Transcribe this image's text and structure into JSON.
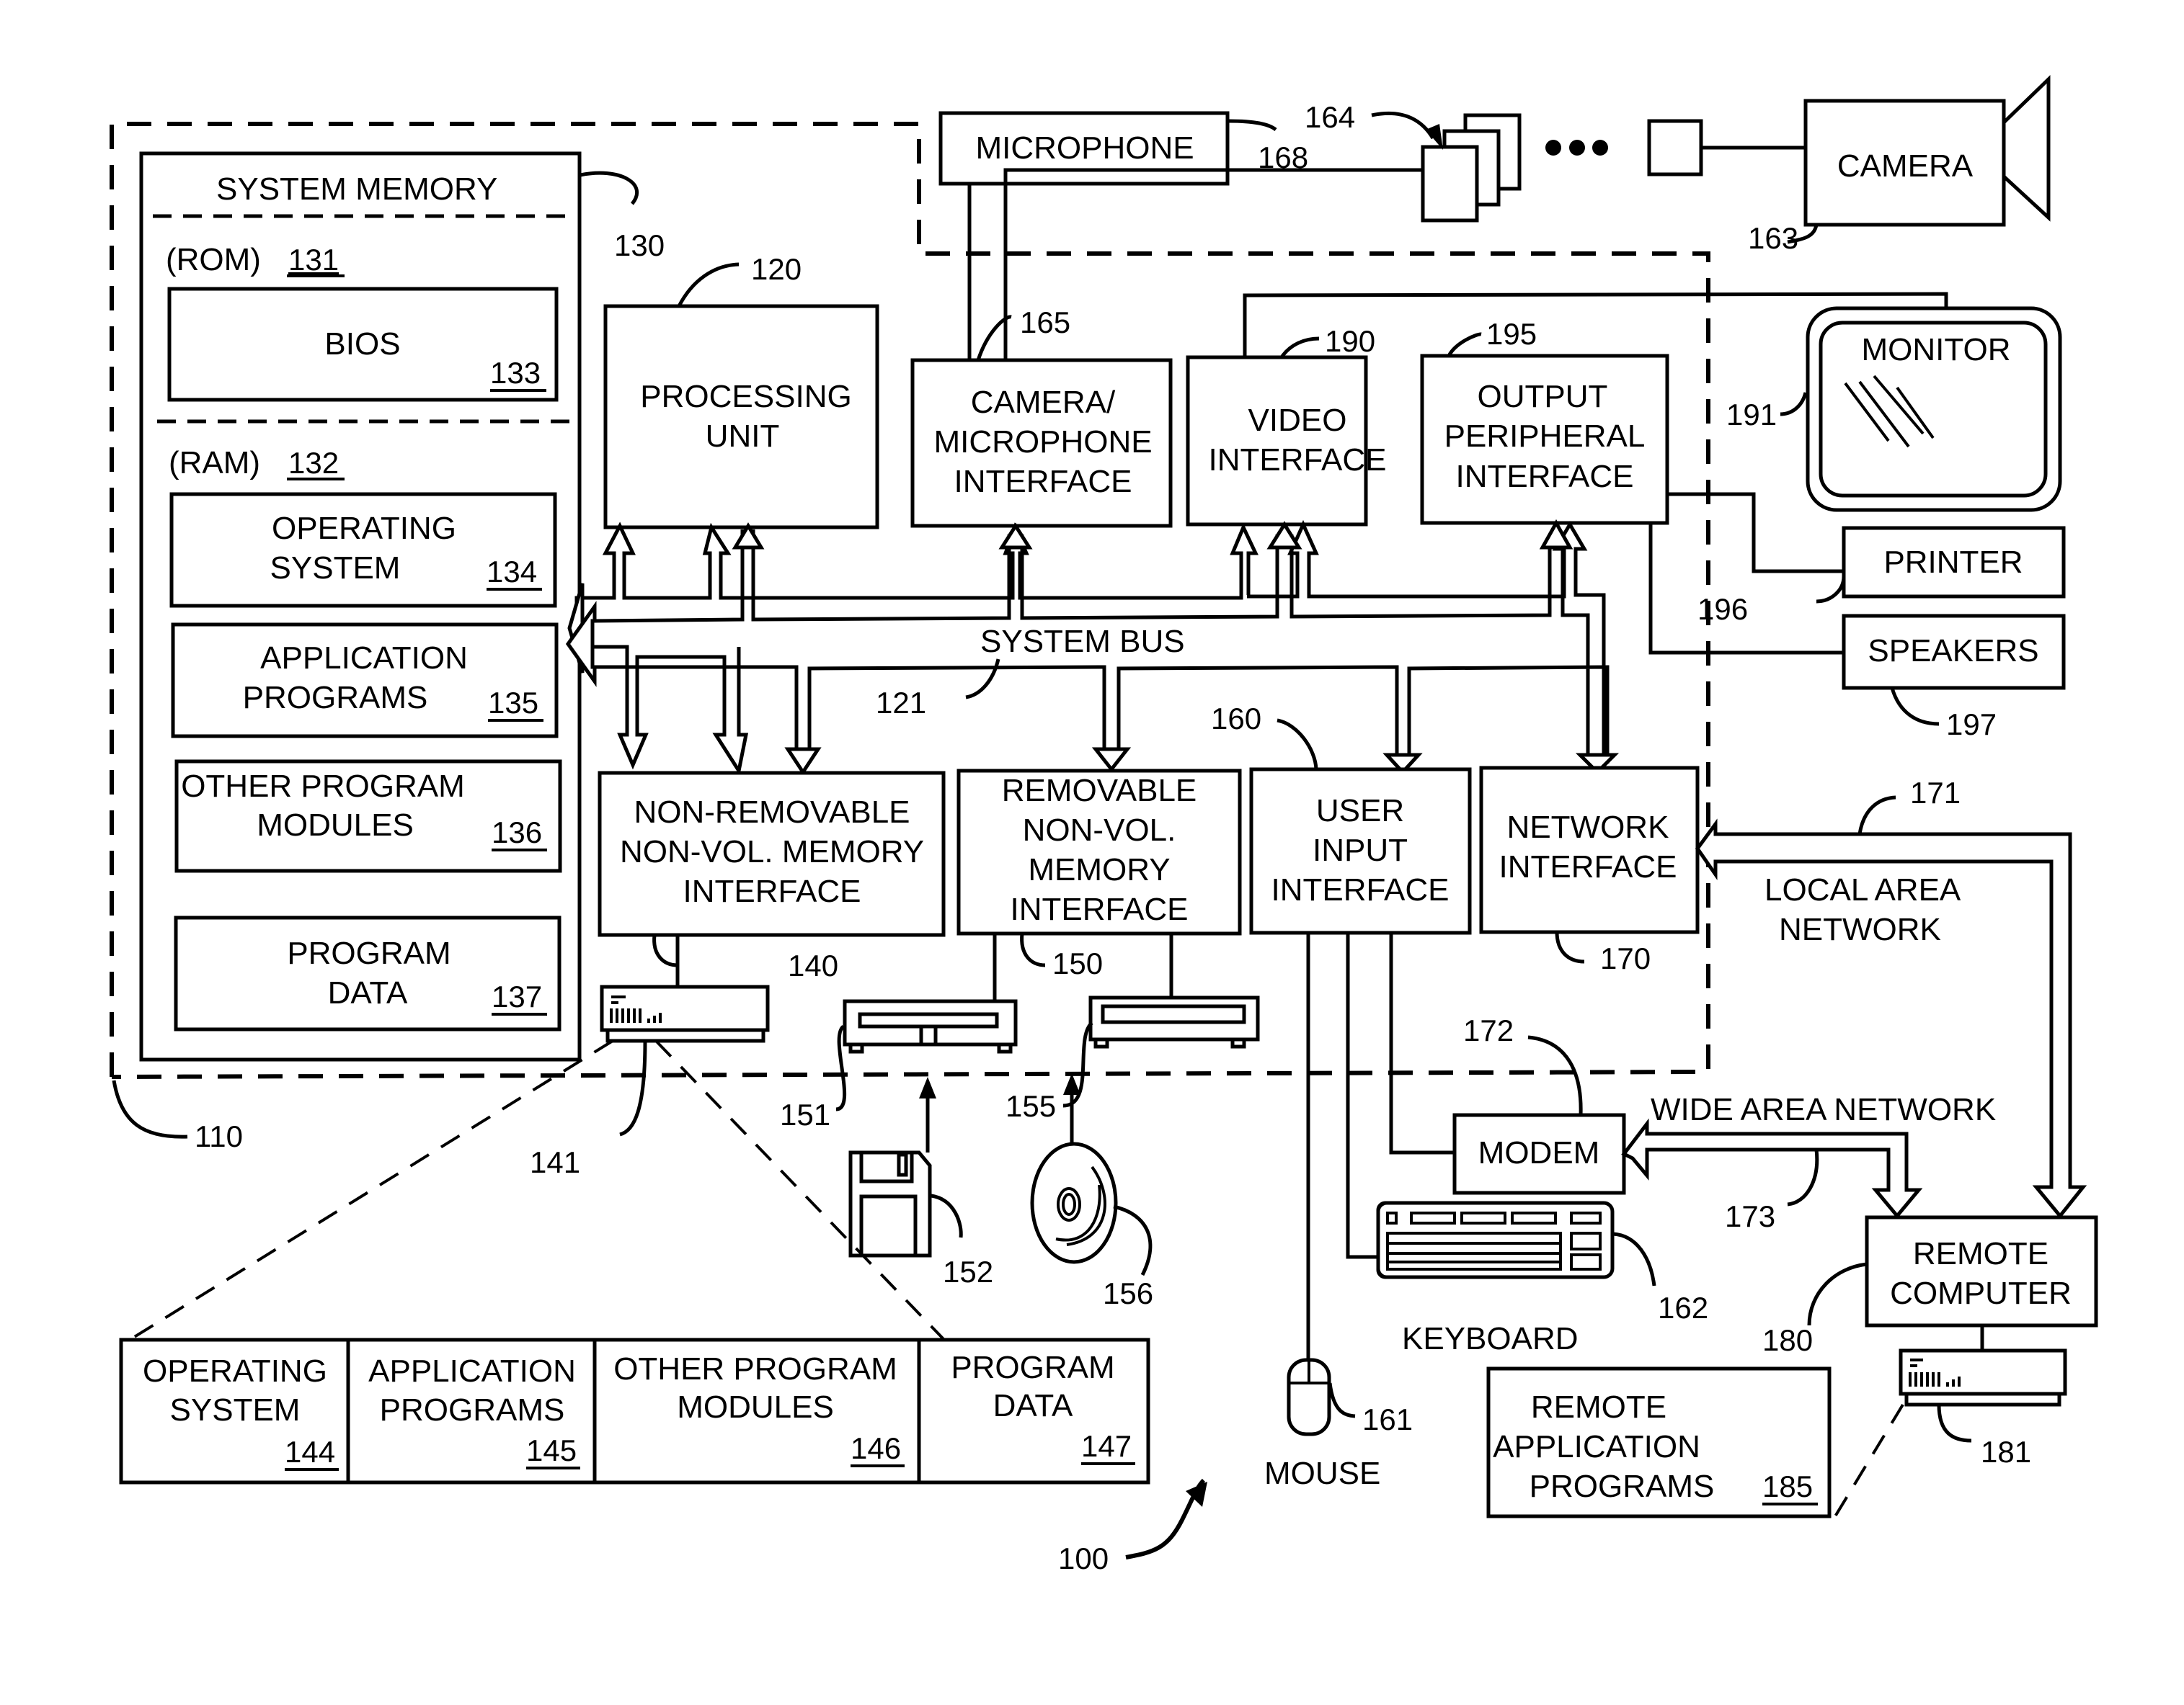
{
  "figure": {
    "system_ref": "100",
    "computer_ref": "110",
    "system_memory": {
      "title": "SYSTEM MEMORY",
      "ref": "130",
      "rom_label": "(ROM)",
      "rom_ref": "131",
      "bios": {
        "label": "BIOS",
        "ref": "133"
      },
      "ram_label": "(RAM)",
      "ram_ref": "132",
      "items": [
        {
          "line1": "OPERATING",
          "line2": "SYSTEM",
          "ref": "134"
        },
        {
          "line1": "APPLICATION",
          "line2": "PROGRAMS",
          "ref": "135"
        },
        {
          "line1": "OTHER PROGRAM",
          "line2": "MODULES",
          "ref": "136"
        },
        {
          "line1": "PROGRAM",
          "line2": "DATA",
          "ref": "137"
        }
      ]
    },
    "processing_unit": {
      "line1": "PROCESSING",
      "line2": "UNIT",
      "ref": "120"
    },
    "camera_mic_interface": {
      "line1": "CAMERA/",
      "line2": "MICROPHONE",
      "line3": "INTERFACE",
      "ref": "165"
    },
    "video_interface": {
      "line1": "VIDEO",
      "line2": "INTERFACE",
      "ref": "190"
    },
    "output_peripheral_interface": {
      "line1": "OUTPUT",
      "line2": "PERIPHERAL",
      "line3": "INTERFACE",
      "ref": "195"
    },
    "system_bus": {
      "label": "SYSTEM BUS",
      "ref": "121"
    },
    "non_removable_interface": {
      "line1": "NON-REMOVABLE",
      "line2": "NON-VOL. MEMORY",
      "line3": "INTERFACE",
      "ref": "140"
    },
    "removable_interface": {
      "line1": "REMOVABLE",
      "line2": "NON-VOL.",
      "line3": "MEMORY",
      "line4": "INTERFACE",
      "ref": "150"
    },
    "user_input_interface": {
      "line1": "USER",
      "line2": "INPUT",
      "line3": "INTERFACE",
      "ref": "160"
    },
    "network_interface": {
      "line1": "NETWORK",
      "line2": "INTERFACE",
      "ref": "170"
    },
    "microphone": {
      "label": "MICROPHONE",
      "ref": "168"
    },
    "cameras_ref": "164",
    "camera": {
      "label": "CAMERA",
      "ref": "163"
    },
    "monitor": {
      "label": "MONITOR",
      "ref": "191"
    },
    "printer": {
      "label": "PRINTER",
      "ref": "196"
    },
    "speakers": {
      "label": "SPEAKERS",
      "ref": "197"
    },
    "lan": {
      "line1": "LOCAL AREA",
      "line2": "NETWORK",
      "ref": "171"
    },
    "wan": {
      "label": "WIDE AREA NETWORK",
      "ref": "173"
    },
    "modem": {
      "label": "MODEM",
      "ref": "172"
    },
    "remote_computer": {
      "line1": "REMOTE",
      "line2": "COMPUTER",
      "ref": "180"
    },
    "remote_storage_ref": "181",
    "remote_apps": {
      "line1": "REMOTE",
      "line2": "APPLICATION",
      "line3": "PROGRAMS",
      "ref": "185"
    },
    "hard_disk_ref": "141",
    "magnetic_drive_ref": "151",
    "floppy_ref": "152",
    "optical_drive_ref": "155",
    "optical_disc_ref": "156",
    "keyboard": {
      "label": "KEYBOARD",
      "ref": "162"
    },
    "mouse": {
      "label": "MOUSE",
      "ref": "161"
    },
    "disk_contents": [
      {
        "line1": "OPERATING",
        "line2": "SYSTEM",
        "ref": "144"
      },
      {
        "line1": "APPLICATION",
        "line2": "PROGRAMS",
        "ref": "145"
      },
      {
        "line1": "OTHER PROGRAM",
        "line2": "MODULES",
        "ref": "146"
      },
      {
        "line1": "PROGRAM",
        "line2": "DATA",
        "ref": "147"
      }
    ]
  }
}
